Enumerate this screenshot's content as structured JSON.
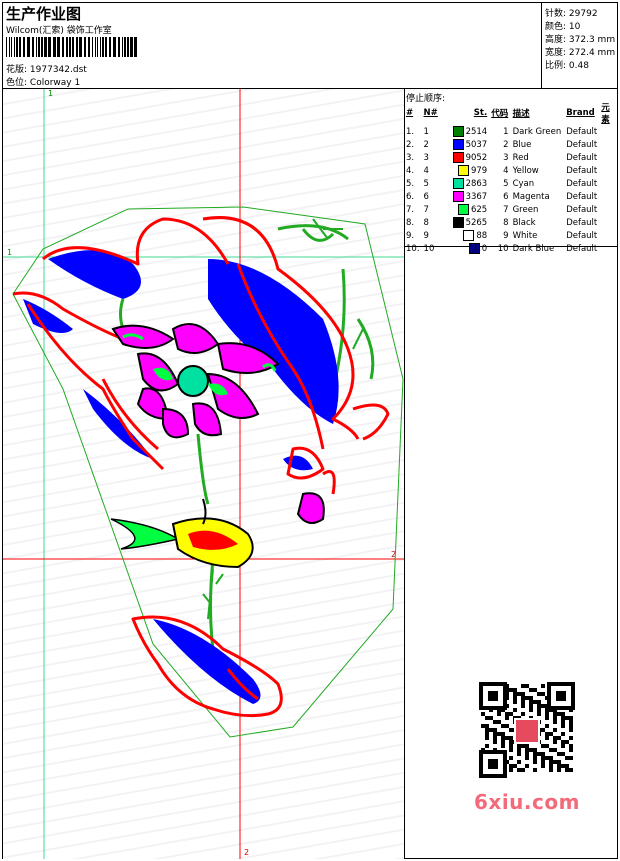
{
  "header": {
    "title": "生产作业图",
    "subtitle": "Wilcom(汇索) 袋饰工作室",
    "design_label": "花版:",
    "design_value": "1977342.dst",
    "colorway_label": "色位:",
    "colorway_value": "Colorway 1"
  },
  "stats": [
    {
      "label": "针数:",
      "value": "29792"
    },
    {
      "label": "颜色:",
      "value": "10"
    },
    {
      "label": "高度:",
      "value": "372.3 mm"
    },
    {
      "label": "宽度:",
      "value": "272.4 mm"
    },
    {
      "label": "比例:",
      "value": "0.48"
    }
  ],
  "stop_table": {
    "title": "停止顺序:",
    "columns": [
      "#",
      "N#",
      "St.",
      "代码",
      "描述",
      "Brand",
      "元素"
    ],
    "rows": [
      {
        "idx": "1.",
        "n": "1",
        "color": "#008000",
        "st": "2514",
        "code": "1",
        "desc": "Dark Green",
        "brand": "Default"
      },
      {
        "idx": "2.",
        "n": "2",
        "color": "#0000ff",
        "st": "5037",
        "code": "2",
        "desc": "Blue",
        "brand": "Default"
      },
      {
        "idx": "3.",
        "n": "3",
        "color": "#ff0000",
        "st": "9052",
        "code": "3",
        "desc": "Red",
        "brand": "Default"
      },
      {
        "idx": "4.",
        "n": "4",
        "color": "#ffff00",
        "st": "979",
        "code": "4",
        "desc": "Yellow",
        "brand": "Default"
      },
      {
        "idx": "5.",
        "n": "5",
        "color": "#00e0a0",
        "st": "2863",
        "code": "5",
        "desc": "Cyan",
        "brand": "Default"
      },
      {
        "idx": "6.",
        "n": "6",
        "color": "#ff00ff",
        "st": "3367",
        "code": "6",
        "desc": "Magenta",
        "brand": "Default"
      },
      {
        "idx": "7.",
        "n": "7",
        "color": "#00ff40",
        "st": "625",
        "code": "7",
        "desc": "Green",
        "brand": "Default"
      },
      {
        "idx": "8.",
        "n": "8",
        "color": "#000000",
        "st": "5265",
        "code": "8",
        "desc": "Black",
        "brand": "Default"
      },
      {
        "idx": "9.",
        "n": "9",
        "color": "#ffffff",
        "st": "88",
        "code": "9",
        "desc": "White",
        "brand": "Default"
      },
      {
        "idx": "10.",
        "n": "10",
        "color": "#000080",
        "st": "0",
        "code": "10",
        "desc": "Dark Blue",
        "brand": "Default"
      }
    ]
  },
  "guides": {
    "v1": "1",
    "h1": "1",
    "h2": "2",
    "v2": "2"
  },
  "watermark": "6xiu.com",
  "colors": {
    "guide_green": "#40d890",
    "guide_red": "#ff0000",
    "outline": "#22aa22"
  }
}
